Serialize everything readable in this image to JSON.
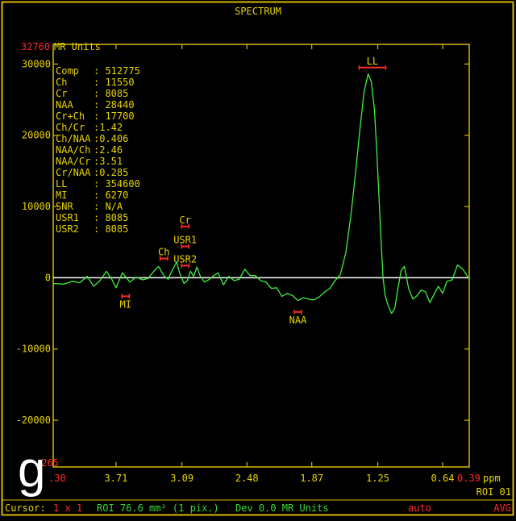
{
  "window": {
    "title": "SPECTRUM"
  },
  "panel_letter": "g",
  "colors": {
    "background": "#000000",
    "frame": "#d8b800",
    "text": "#e8d400",
    "spectrum": "#3ef03e",
    "baseline": "#ffffff",
    "marker": "#ff2a2a",
    "status_green": "#39d839"
  },
  "status_bar": {
    "cursor_label": "Cursor:",
    "cursor_value": "1 x 1",
    "roi": "ROI 76.6 mm² (1 pix.)",
    "dev": "Dev 0.0 MR Units",
    "mode": "auto",
    "avg": "AVG",
    "roi_id": "ROI 01"
  },
  "metabolite_table": {
    "rows": [
      {
        "label": "Comp",
        "value": ": 512775"
      },
      {
        "label": "Ch",
        "value": ": 11550"
      },
      {
        "label": "Cr",
        "value": ": 8085"
      },
      {
        "label": "NAA",
        "value": ": 28440"
      },
      {
        "label": "Cr+Ch",
        "value": ": 17700"
      },
      {
        "label": "Ch/Cr",
        "value": ":1.42"
      },
      {
        "label": "Ch/NAA",
        "value": ":0.406"
      },
      {
        "label": "NAA/Ch",
        "value": ":2.46"
      },
      {
        "label": "NAA/Cr",
        "value": ":3.51"
      },
      {
        "label": "Cr/NAA",
        "value": ":0.285"
      },
      {
        "label": "LL",
        "value": ": 354600"
      },
      {
        "label": "MI",
        "value": ": 6270"
      },
      {
        "label": "SNR",
        "value": ": N/A"
      },
      {
        "label": "USR1",
        "value": ": 8085"
      },
      {
        "label": "USR2",
        "value": ": 8085"
      }
    ]
  },
  "chart_data": {
    "type": "line",
    "title": "SPECTRUM",
    "ylabel": "MR Units",
    "xlabel": "ppm",
    "x_reversed": true,
    "xlim": [
      4.3,
      0.39
    ],
    "ylim": [
      -26560,
      32760
    ],
    "y_max_label": "32760",
    "y_min_label": "-265",
    "x_min_label": ".30",
    "x_max_label": "0.39",
    "x_ticks": [
      "3.71",
      "3.09",
      "2.48",
      "1.87",
      "1.25",
      "0.64"
    ],
    "y_ticks": [
      "30000",
      "20000",
      "10000",
      "0",
      "-10000",
      "-20000"
    ],
    "x_tick_values": [
      3.71,
      3.09,
      2.48,
      1.87,
      1.25,
      0.64
    ],
    "y_tick_values": [
      30000,
      20000,
      10000,
      0,
      -10000,
      -20000
    ],
    "baseline": 0,
    "grid": false,
    "series": [
      {
        "x": [
          4.3,
          4.2,
          4.12,
          4.05,
          3.98,
          3.92,
          3.86,
          3.8,
          3.75,
          3.71,
          3.65,
          3.58,
          3.52,
          3.46,
          3.41,
          3.36,
          3.31,
          3.26,
          3.22,
          3.18,
          3.14,
          3.11,
          3.07,
          3.04,
          3.01,
          2.98,
          2.95,
          2.92,
          2.88,
          2.84,
          2.8,
          2.75,
          2.7,
          2.65,
          2.6,
          2.55,
          2.5,
          2.45,
          2.4,
          2.35,
          2.3,
          2.25,
          2.2,
          2.15,
          2.1,
          2.05,
          2.0,
          1.95,
          1.9,
          1.85,
          1.8,
          1.75,
          1.7,
          1.65,
          1.6,
          1.55,
          1.5,
          1.46,
          1.42,
          1.38,
          1.34,
          1.31,
          1.28,
          1.26,
          1.24,
          1.22,
          1.2,
          1.18,
          1.15,
          1.12,
          1.09,
          1.06,
          1.03,
          1.0,
          0.96,
          0.92,
          0.88,
          0.84,
          0.8,
          0.76,
          0.72,
          0.68,
          0.64,
          0.6,
          0.55,
          0.5,
          0.45,
          0.39
        ],
        "y": [
          -800,
          -900,
          -500,
          -700,
          200,
          -1200,
          -400,
          900,
          -200,
          -1400,
          700,
          -600,
          100,
          -300,
          -100,
          800,
          1600,
          300,
          -200,
          1100,
          2200,
          600,
          -800,
          -400,
          900,
          200,
          1500,
          300,
          -600,
          -300,
          200,
          700,
          -1000,
          200,
          -400,
          -200,
          1200,
          300,
          300,
          -400,
          -600,
          -1500,
          -1400,
          -2600,
          -2200,
          -2500,
          -3200,
          -2800,
          -3000,
          -3100,
          -2700,
          -2000,
          -1500,
          -400,
          500,
          3500,
          9000,
          14500,
          20500,
          26000,
          28600,
          27500,
          23500,
          18000,
          12000,
          5500,
          0,
          -2500,
          -4000,
          -5000,
          -4300,
          -1500,
          1000,
          1600,
          -1500,
          -3000,
          -2500,
          -1700,
          -2000,
          -3500,
          -2300,
          -1200,
          -2200,
          -500,
          -300,
          1800,
          1200,
          -200
        ]
      }
    ],
    "peak_markers": [
      {
        "label": "LL",
        "center_ppm": 1.3,
        "half_width_ppm": 0.125,
        "value": 29500,
        "label_side": "above"
      },
      {
        "label": "Cr",
        "center_ppm": 3.06,
        "half_width_ppm": 0.035,
        "value": 7200,
        "label_side": "above"
      },
      {
        "label": "USR1",
        "center_ppm": 3.06,
        "half_width_ppm": 0.035,
        "value": 4400,
        "label_side": "above"
      },
      {
        "label": "Ch",
        "center_ppm": 3.26,
        "half_width_ppm": 0.035,
        "value": 2700,
        "label_side": "above"
      },
      {
        "label": "USR2",
        "center_ppm": 3.06,
        "half_width_ppm": 0.035,
        "value": 1700,
        "label_side": "above"
      },
      {
        "label": "MI",
        "center_ppm": 3.62,
        "half_width_ppm": 0.035,
        "value": -2600,
        "label_side": "below"
      },
      {
        "label": "NAA",
        "center_ppm": 2.0,
        "half_width_ppm": 0.035,
        "value": -4800,
        "label_side": "below"
      }
    ]
  }
}
